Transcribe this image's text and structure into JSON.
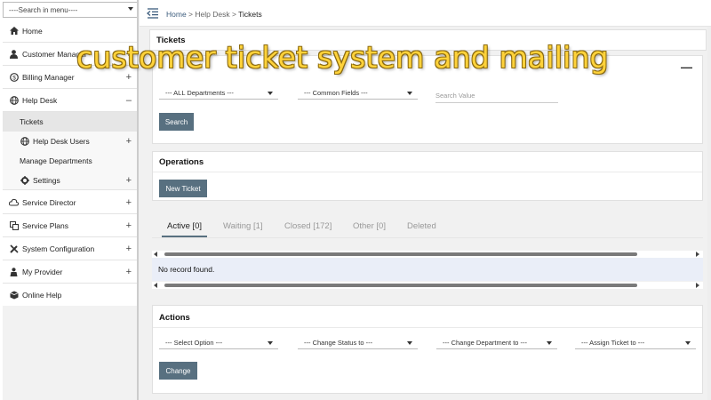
{
  "sidebar": {
    "search_label": "----Search in menu----",
    "items": [
      {
        "label": "Home",
        "icon": "home-icon",
        "expand": ""
      },
      {
        "label": "Customer Manager",
        "icon": "user-icon",
        "expand": "+"
      },
      {
        "label": "Billing Manager",
        "icon": "dollar-icon",
        "expand": "+"
      },
      {
        "label": "Help Desk",
        "icon": "globe-icon",
        "expand": "–"
      },
      {
        "label": "Tickets",
        "icon": "",
        "expand": ""
      },
      {
        "label": "Help Desk Users",
        "icon": "globe-icon",
        "expand": "+"
      },
      {
        "label": "Manage Departments",
        "icon": "",
        "expand": ""
      },
      {
        "label": "Settings",
        "icon": "gear-icon",
        "expand": "+"
      },
      {
        "label": "Service Director",
        "icon": "cloud-icon",
        "expand": "+"
      },
      {
        "label": "Service Plans",
        "icon": "plans-icon",
        "expand": "+"
      },
      {
        "label": "System Configuration",
        "icon": "wrench-icon",
        "expand": "+"
      },
      {
        "label": "My Provider",
        "icon": "provider-icon",
        "expand": "+"
      },
      {
        "label": "Online Help",
        "icon": "box-icon",
        "expand": ""
      }
    ]
  },
  "breadcrumb": {
    "home": "Home",
    "sep1": " > ",
    "section": "Help Desk",
    "sep2": " > ",
    "current": "Tickets"
  },
  "tickets_panel": {
    "title": "Tickets"
  },
  "search": {
    "department_select": "--- ALL Departments ---",
    "field_select": "--- Common Fields ---",
    "value_placeholder": "Search Value",
    "search_button": "Search"
  },
  "operations": {
    "title": "Operations",
    "new_ticket_button": "New Ticket"
  },
  "tabs": [
    {
      "label": "Active [0]"
    },
    {
      "label": "Waiting [1]"
    },
    {
      "label": "Closed [172]"
    },
    {
      "label": "Other [0]"
    },
    {
      "label": "Deleted"
    }
  ],
  "table": {
    "empty_message": "No record found."
  },
  "actions": {
    "title": "Actions",
    "select_option": "--- Select Option ---",
    "change_status": "--- Change Status to ---",
    "change_department": "--- Change Department to ---",
    "assign_ticket": "--- Assign Ticket to ---",
    "change_button": "Change"
  },
  "overlay": {
    "text": "customer ticket system and mailing"
  },
  "colors": {
    "button": "#587080",
    "breadcrumb_link": "#3c5c7d",
    "overlay_text": "#ffd23a",
    "empty_row_bg": "#eaeef8"
  }
}
